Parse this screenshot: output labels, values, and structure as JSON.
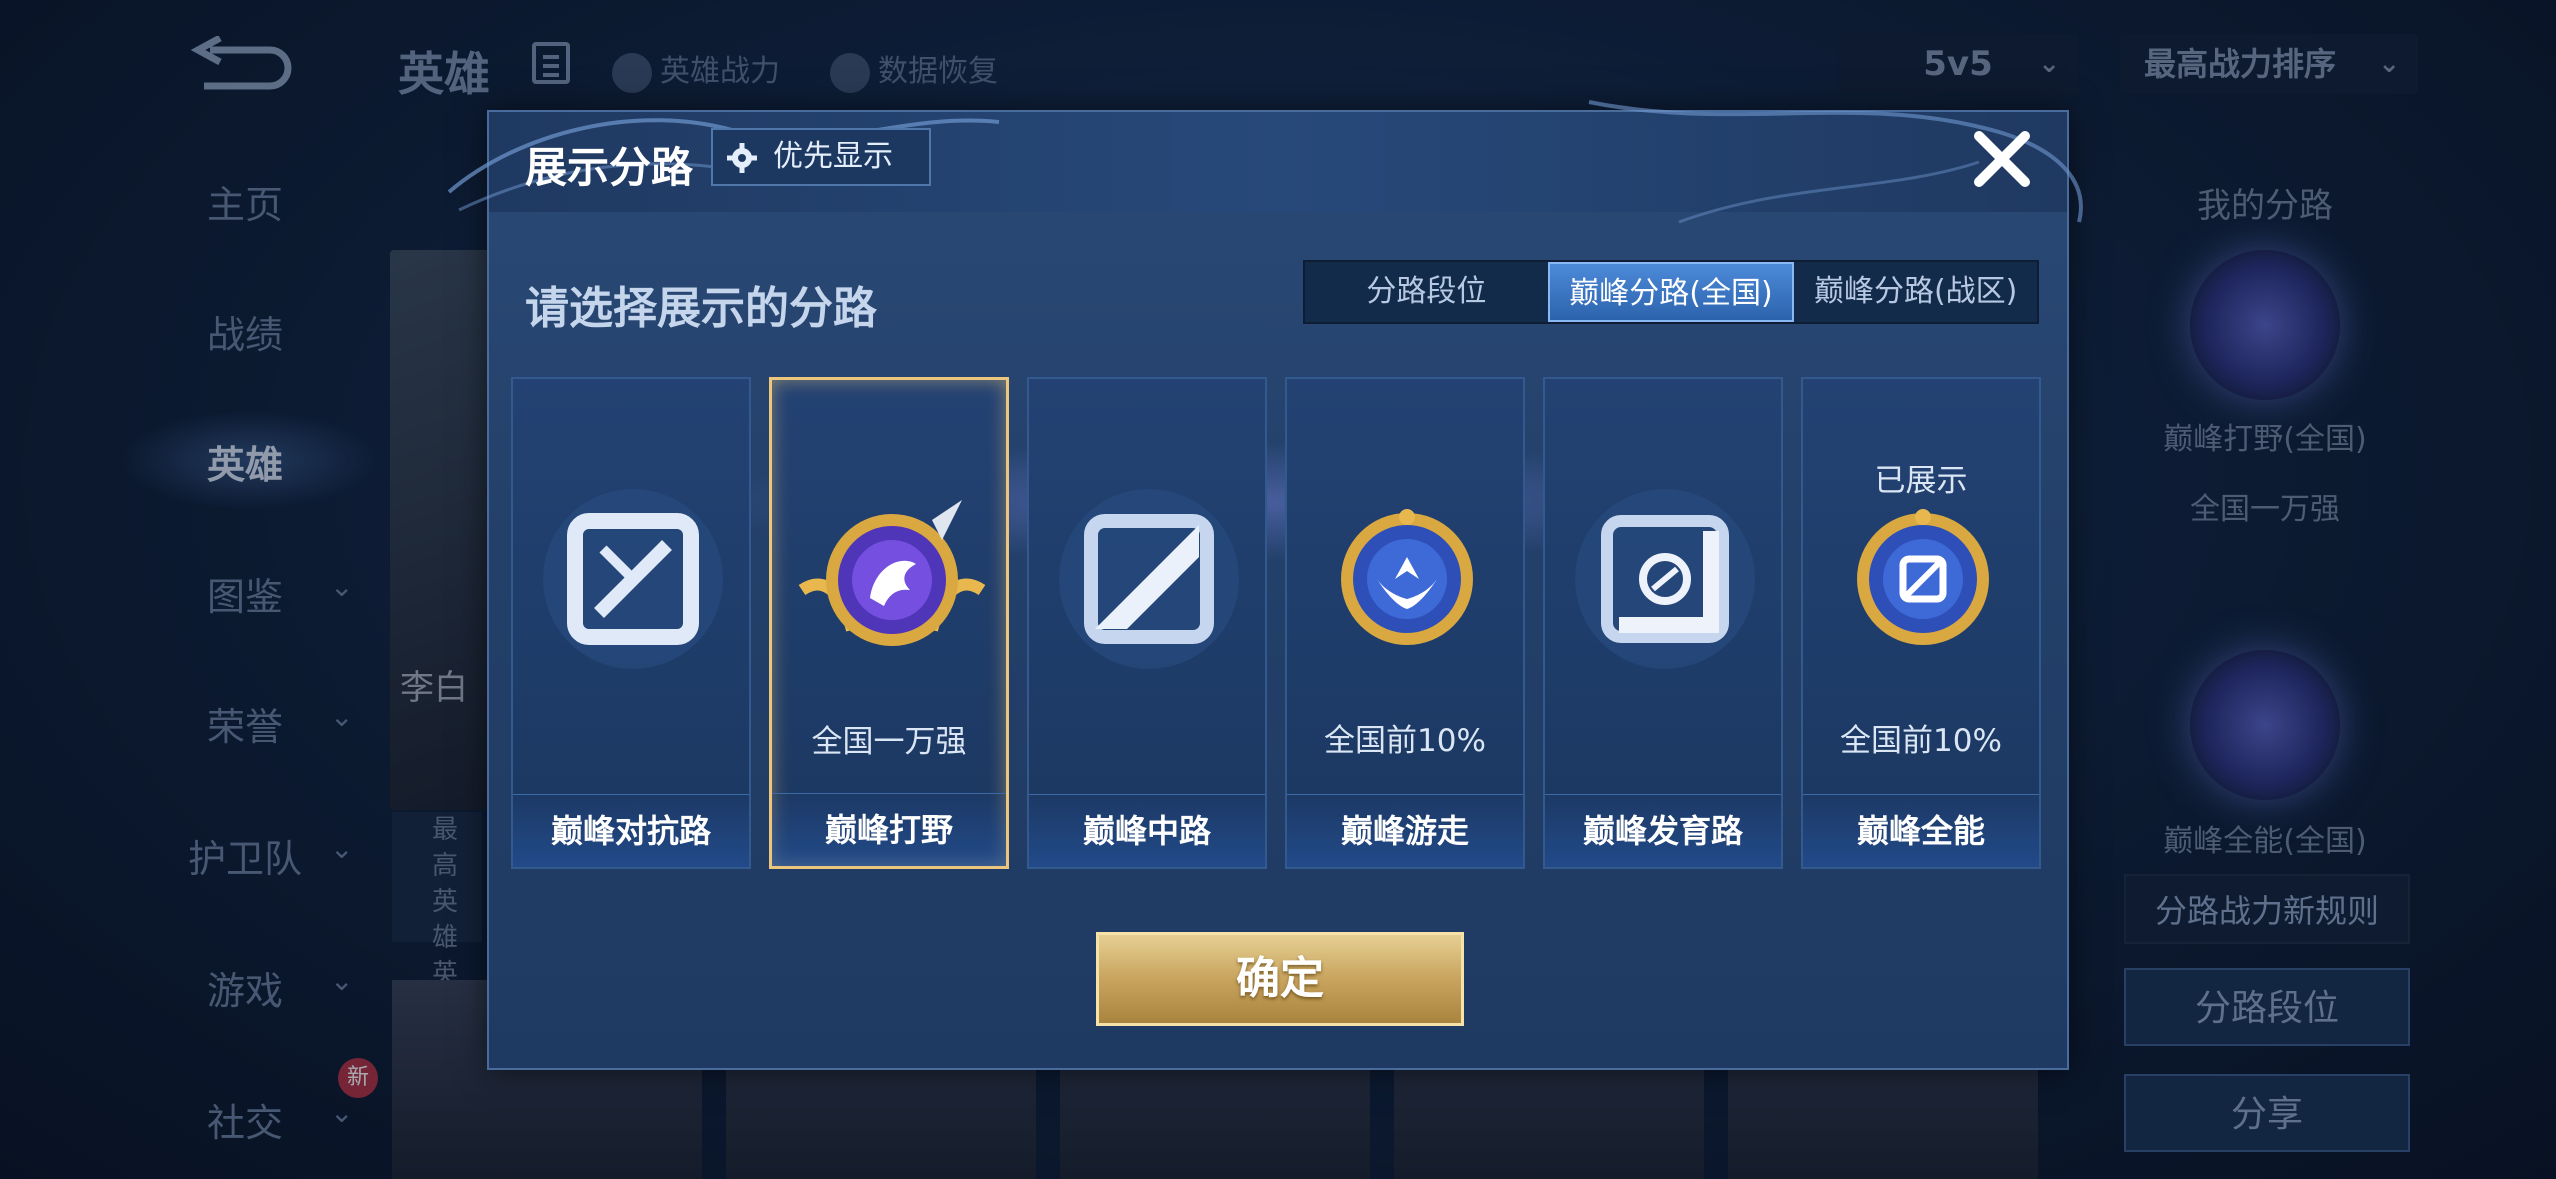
{
  "background": {
    "page_title": "英雄",
    "links": [
      {
        "label": "英雄战力",
        "icon": "helmet-icon"
      },
      {
        "label": "数据恢复",
        "icon": "restore-icon"
      }
    ],
    "mode_select": "5v5",
    "sort_select": "最高战力排序",
    "sidebar": [
      {
        "label": "主页"
      },
      {
        "label": "战绩"
      },
      {
        "label": "英雄",
        "active": true
      },
      {
        "label": "图鉴",
        "chevron": true
      },
      {
        "label": "荣誉",
        "chevron": true
      },
      {
        "label": "护卫队",
        "chevron": true
      },
      {
        "label": "游戏",
        "chevron": true
      },
      {
        "label": "社交",
        "chevron": true,
        "badge": "新"
      }
    ],
    "hero_name": "李白",
    "hero_info_lines": [
      "最高",
      "英雄",
      "英雄"
    ],
    "right_panel": {
      "my_lanes_title": "我的分路",
      "lane1_label": "巅峰打野(全国)",
      "lane1_rank": "全国一万强",
      "lane2_label": "巅峰全能(全国)",
      "rule_btn": "分路战力新规则",
      "lane_rank_btn": "分路段位",
      "share_btn": "分享"
    }
  },
  "dialog": {
    "title": "展示分路",
    "priority_button": "优先显示",
    "prompt": "请选择展示的分路",
    "tabs": [
      {
        "label": "分路段位",
        "active": false
      },
      {
        "label": "巅峰分路(全国)",
        "active": true
      },
      {
        "label": "巅峰分路(战区)",
        "active": false
      }
    ],
    "cards": [
      {
        "label": "巅峰对抗路",
        "status": "",
        "emblem": "sword-lane-icon",
        "selected": false,
        "shown": ""
      },
      {
        "label": "巅峰打野",
        "status": "全国一万强",
        "emblem": "dragon-badge-icon",
        "selected": true,
        "shown": ""
      },
      {
        "label": "巅峰中路",
        "status": "",
        "emblem": "mid-lane-icon",
        "selected": false,
        "shown": ""
      },
      {
        "label": "巅峰游走",
        "status": "全国前10%",
        "emblem": "wings-badge-icon",
        "selected": false,
        "shown": ""
      },
      {
        "label": "巅峰发育路",
        "status": "",
        "emblem": "farm-lane-icon",
        "selected": false,
        "shown": ""
      },
      {
        "label": "巅峰全能",
        "status": "全国前10%",
        "emblem": "allround-badge-icon",
        "selected": false,
        "shown": "已展示"
      }
    ],
    "confirm_button": "确定"
  },
  "colors": {
    "accent_gold": "#ecc67c",
    "tab_active": "#3b78c8",
    "dialog_bg": "#23406a"
  }
}
